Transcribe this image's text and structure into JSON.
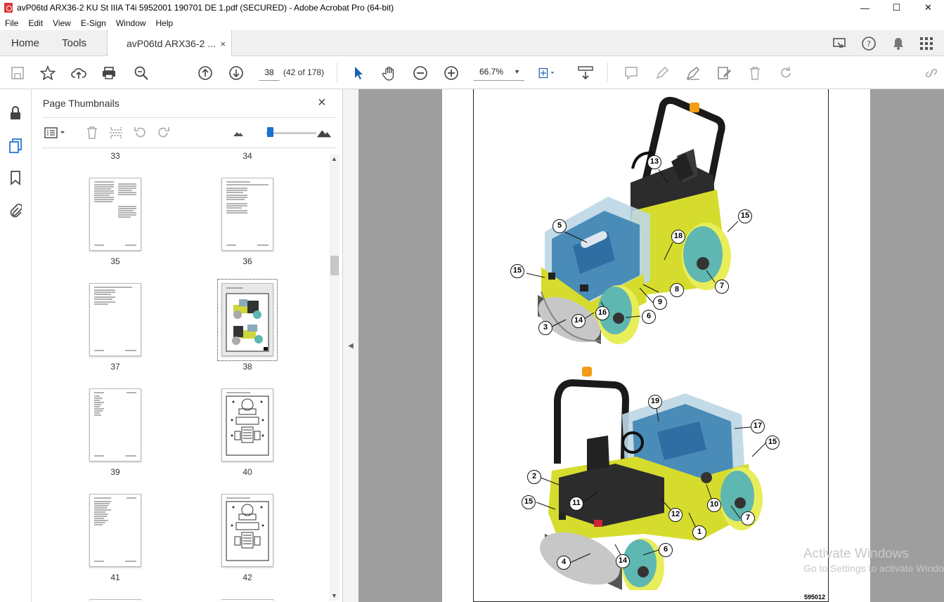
{
  "window": {
    "title": "avP06td ARX36-2 KU St IIIA T4i 5952001 190701 DE 1.pdf (SECURED) - Adobe Acrobat Pro (64-bit)",
    "minimize": "—",
    "maximize": "☐",
    "close": "✕"
  },
  "menu": [
    "File",
    "Edit",
    "View",
    "E-Sign",
    "Window",
    "Help"
  ],
  "tabs": {
    "home": "Home",
    "tools": "Tools",
    "doc": "avP06td ARX36-2 ...",
    "doc_close": "×"
  },
  "toolbar": {
    "page_current": "38",
    "page_of": "(42 of 178)",
    "zoom": "66.7%"
  },
  "panel": {
    "title": "Page Thumbnails",
    "close": "×",
    "top_labels": [
      "33",
      "34"
    ],
    "thumbnails": [
      {
        "label": "35",
        "kind": "text"
      },
      {
        "label": "36",
        "kind": "text"
      },
      {
        "label": "37",
        "kind": "text"
      },
      {
        "label": "38",
        "kind": "image",
        "selected": true
      },
      {
        "label": "39",
        "kind": "text"
      },
      {
        "label": "40",
        "kind": "diagram"
      },
      {
        "label": "41",
        "kind": "text"
      },
      {
        "label": "42",
        "kind": "diagram"
      }
    ]
  },
  "document": {
    "figure_id": "595012",
    "callouts_top": [
      "13",
      "15",
      "5",
      "18",
      "15",
      "7",
      "8",
      "9",
      "16",
      "6",
      "14",
      "3"
    ],
    "callouts_bottom": [
      "19",
      "17",
      "15",
      "2",
      "11",
      "15",
      "10",
      "12",
      "1",
      "7",
      "6",
      "14",
      "4"
    ]
  },
  "watermark": {
    "line1": "Activate Windows",
    "line2": "Go to Settings to activate Windows."
  }
}
